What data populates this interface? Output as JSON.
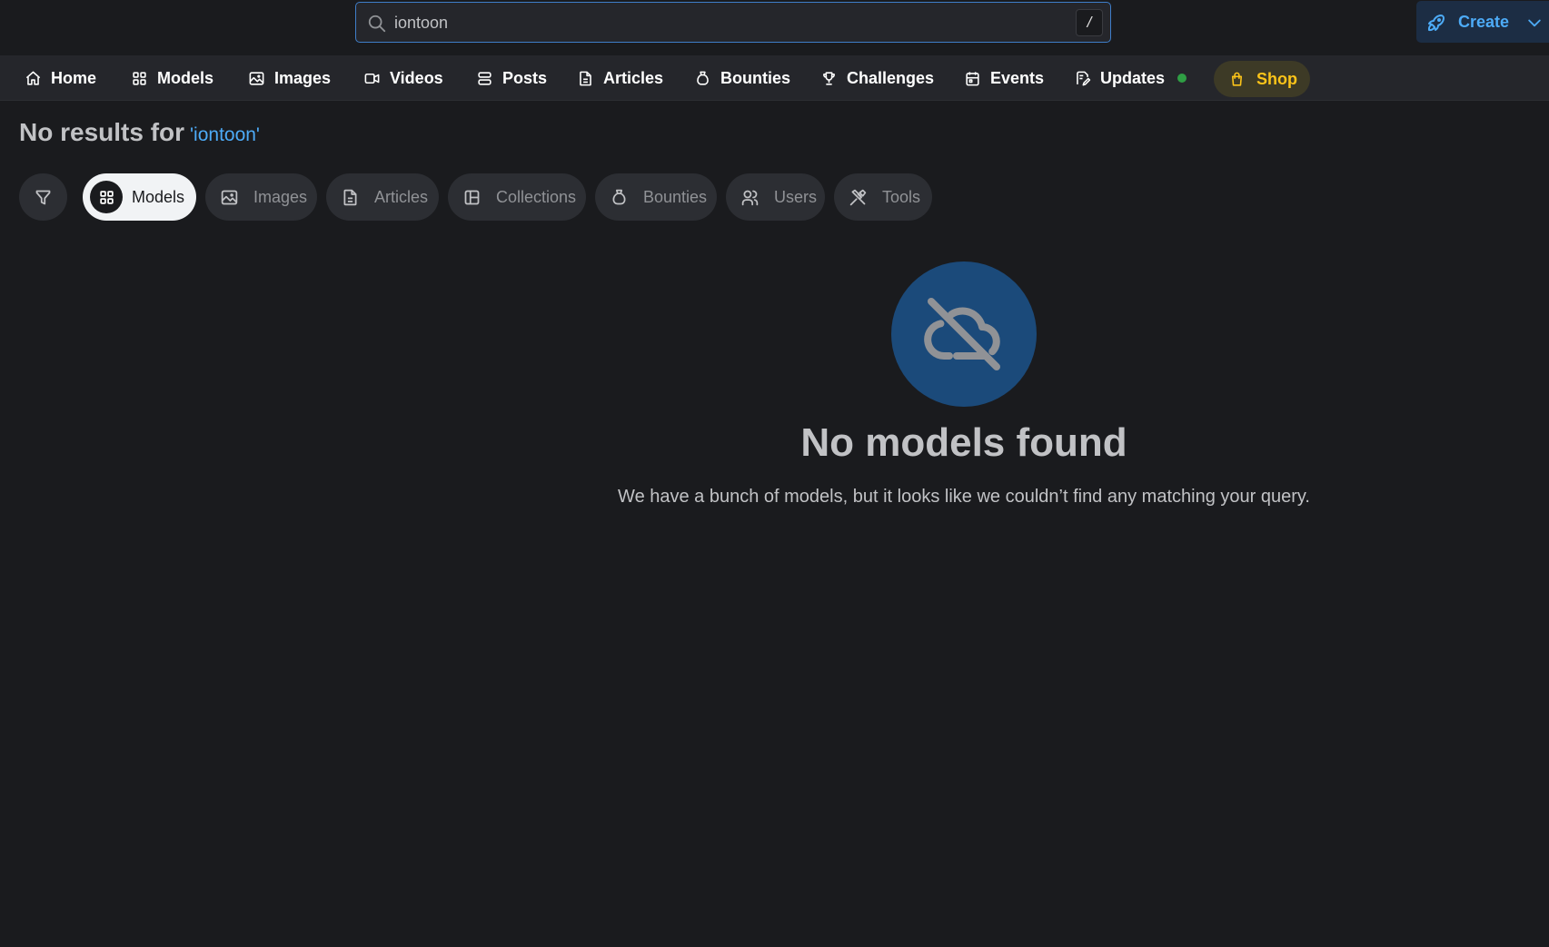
{
  "search": {
    "value": "iontoon",
    "shortcut": "/"
  },
  "header": {
    "create_label": "Create"
  },
  "nav": {
    "items": [
      {
        "label": "Home",
        "icon": "home-icon"
      },
      {
        "label": "Models",
        "icon": "grid-icon"
      },
      {
        "label": "Images",
        "icon": "photo-icon"
      },
      {
        "label": "Videos",
        "icon": "video-icon"
      },
      {
        "label": "Posts",
        "icon": "layers-icon"
      },
      {
        "label": "Articles",
        "icon": "file-text-icon"
      },
      {
        "label": "Bounties",
        "icon": "moneybag-icon"
      },
      {
        "label": "Challenges",
        "icon": "trophy-icon"
      },
      {
        "label": "Events",
        "icon": "calendar-icon"
      },
      {
        "label": "Updates",
        "icon": "edit-file-icon"
      }
    ],
    "shop_label": "Shop"
  },
  "results": {
    "prefix": "No results for",
    "query": "'iontoon'"
  },
  "chips": [
    {
      "label": "Models",
      "icon": "grid-icon",
      "active": true
    },
    {
      "label": "Images",
      "icon": "photo-icon",
      "active": false
    },
    {
      "label": "Articles",
      "icon": "file-text-icon",
      "active": false
    },
    {
      "label": "Collections",
      "icon": "layout-icon",
      "active": false
    },
    {
      "label": "Bounties",
      "icon": "moneybag-icon",
      "active": false
    },
    {
      "label": "Users",
      "icon": "users-icon",
      "active": false
    },
    {
      "label": "Tools",
      "icon": "tools-icon",
      "active": false
    }
  ],
  "empty": {
    "title": "No models found",
    "description": "We have a bunch of models, but it looks like we couldn’t find any matching your query."
  },
  "colors": {
    "background": "#1a1b1e",
    "navbar": "#25262b",
    "accent": "#4dabf7",
    "shop": "#fcc419",
    "status_dot": "#2f9e44",
    "empty_circle": "#1b4a7a"
  }
}
